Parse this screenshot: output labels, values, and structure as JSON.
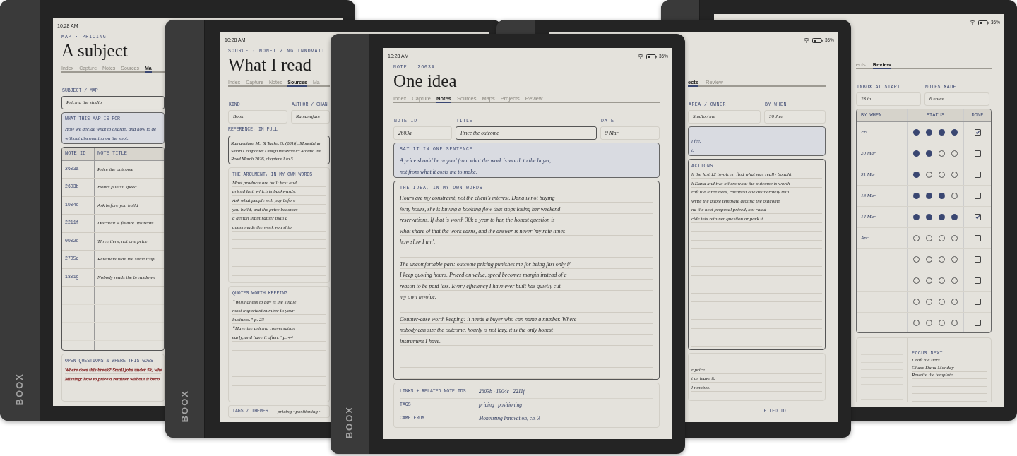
{
  "devices": [
    {
      "kind": "map",
      "brand": "BOOX",
      "status_bar": {
        "time": "10:28 AM"
      },
      "eyebrow": "MAP · PRICING",
      "title": "A subject",
      "tabs": [
        {
          "label": "Index",
          "selected": false
        },
        {
          "label": "Capture",
          "selected": false
        },
        {
          "label": "Notes",
          "selected": false
        },
        {
          "label": "Sources",
          "selected": false
        },
        {
          "label": "Ma",
          "selected": true
        }
      ],
      "sections": [
        {
          "kind": "fields",
          "fields": [
            {
              "label": "SUBJECT / MAP",
              "value": "Pricing the studio",
              "focused": true
            }
          ]
        },
        {
          "kind": "callout",
          "label": "WHAT THIS MAP IS FOR",
          "lines": [
            "How we decide what to charge, and how to de",
            "without discounting on the spot."
          ]
        },
        {
          "kind": "table",
          "columns": [
            "NOTE ID",
            "NOTE TITLE"
          ],
          "rows": [
            {
              "cells": [
                "2603a",
                "Price the outcome"
              ]
            },
            {
              "cells": [
                "2603b",
                "Hours punish speed"
              ]
            },
            {
              "cells": [
                "1904c",
                "Ask before you build"
              ]
            },
            {
              "cells": [
                "2211f",
                "Discount = failure upstream."
              ]
            },
            {
              "cells": [
                "0902d",
                "Three tiers, not one price"
              ]
            },
            {
              "cells": [
                "2705e",
                "Retainers hide the same trap"
              ]
            },
            {
              "cells": [
                "1801g",
                "Nobody reads the breakdown"
              ]
            }
          ]
        },
        {
          "kind": "ruled_card",
          "label": "OPEN QUESTIONS & WHERE THIS GOES",
          "color": "#8a2f2f",
          "paragraphs": [
            [
              "Where does this break? Small jobs under 5k, whe",
              "Missing: how to price a retainer without it beco"
            ]
          ]
        }
      ]
    },
    {
      "kind": "source",
      "brand": "BOOX",
      "status_bar": {
        "time": "10:28 AM"
      },
      "eyebrow": "SOURCE · MONETIZING INNOVATI",
      "title": "What I read",
      "tabs": [
        {
          "label": "Index",
          "selected": false
        },
        {
          "label": "Capture",
          "selected": false
        },
        {
          "label": "Notes",
          "selected": false
        },
        {
          "label": "Sources",
          "selected": true
        },
        {
          "label": "Ma",
          "selected": false
        }
      ],
      "sections": [
        {
          "kind": "fields",
          "fields": [
            {
              "label": "KIND",
              "value": "Book",
              "focused": false
            },
            {
              "label": "AUTHOR / CHAN",
              "value": "Ramanujam",
              "focused": false
            }
          ]
        },
        {
          "kind": "reference",
          "label": "REFERENCE, IN FULL",
          "lines": [
            "Ramanujam, M., & Tacke, G. (2016). Monetizing",
            "Smart Companies Design the Product Around the",
            "Read March 2026, chapters 1 to 3."
          ]
        },
        {
          "kind": "ruled_panel",
          "label": "THE ARGUMENT, IN MY OWN WORDS",
          "paragraphs": [
            [
              "Most products are built first and",
              "priced last, which is backwards.",
              "Ask what people will pay before",
              "you build, and the price becomes",
              "a design input rather than a",
              "guess made the week you ship."
            ]
          ]
        },
        {
          "kind": "ruled_panel",
          "label": "QUOTES WORTH KEEPING",
          "paragraphs": [
            [
              "“Willingness to pay is the single",
              "most important number in your",
              "business.” p. 23",
              "“Have the pricing conversation",
              "early, and have it often.” p. 44"
            ]
          ]
        },
        {
          "kind": "tags",
          "label": "TAGS / THEMES",
          "value": "pricing · positioning ·"
        }
      ]
    },
    {
      "kind": "note",
      "brand": "BOOX",
      "status_bar": {
        "time": "10:28 AM",
        "battery": "36%"
      },
      "eyebrow": "NOTE · 2603A",
      "title": "One idea",
      "tabs": [
        {
          "label": "Index",
          "selected": false
        },
        {
          "label": "Capture",
          "selected": false
        },
        {
          "label": "Notes",
          "selected": true
        },
        {
          "label": "Sources",
          "selected": false
        },
        {
          "label": "Maps",
          "selected": false
        },
        {
          "label": "Projects",
          "selected": false
        },
        {
          "label": "Review",
          "selected": false
        }
      ],
      "sections": [
        {
          "kind": "fields",
          "fields": [
            {
              "label": "NOTE ID",
              "value": "2603a",
              "focused": false
            },
            {
              "label": "TITLE",
              "value": "Price the outcome",
              "focused": true
            },
            {
              "label": "DATE",
              "value": "9 Mar",
              "focused": false
            }
          ]
        },
        {
          "kind": "callout",
          "label": "SAY IT IN ONE SENTENCE",
          "lines": [
            "A price should be argued from what the work is worth to the buyer,",
            "not from what it costs me to make."
          ]
        },
        {
          "kind": "ruled_box",
          "label": "THE IDEA, IN MY OWN WORDS",
          "paragraphs": [
            [
              "Hours are my constraint, not the client's interest. Dana is not buying",
              "forty hours, she is buying a booking flow that stops losing her weekend",
              "reservations. If that is worth 30k a year to her, the honest question is",
              "what share of that the work earns, and the answer is never 'my rate times",
              "how slow I am'."
            ],
            [
              "The uncomfortable part: outcome pricing punishes me for being fast only if",
              "I keep quoting hours. Priced on value, speed becomes margin instead of a",
              "reason to be paid less. Every efficiency I have ever built has quietly cut",
              "my own invoice."
            ],
            [
              "Counter-case worth keeping: it needs a buyer who can name a number. Where",
              "nobody can size the outcome, hourly is not lazy, it is the only honest",
              "instrument I have."
            ]
          ]
        },
        {
          "kind": "meta",
          "rows": [
            {
              "label": "LINKS + RELATED NOTE IDS",
              "value": "2603b · 1904c · 2211f"
            },
            {
              "label": "TAGS",
              "value": "pricing · positioning"
            },
            {
              "label": "CAME FROM",
              "value": "Monetizing Innovation, ch. 3"
            }
          ]
        }
      ]
    },
    {
      "kind": "project",
      "status_bar": {
        "battery": "36%"
      },
      "tabs": [
        {
          "label": "ects",
          "selected": true
        },
        {
          "label": "Review",
          "selected": false
        }
      ],
      "sections": [
        {
          "kind": "fields",
          "fields": [
            {
              "label": "AREA / OWNER",
              "value": "Studio / me",
              "focused": false
            },
            {
              "label": "BY WHEN",
              "value": "30 Jun",
              "focused": false
            }
          ]
        },
        {
          "kind": "callout",
          "lines": [
            "l fee.",
            "t."
          ]
        },
        {
          "kind": "ruled_box",
          "label": "ACTIONS",
          "paragraphs": [
            [
              "ll the last 12 invoices; find what was really bought",
              "k Dana and two others what the outcome is worth",
              "raft the three tiers, cheapest one deliberately thin",
              "write the quote template around the outcome",
              "nd the next proposal priced, not rated",
              "cide this retainer question or park it"
            ]
          ]
        },
        {
          "kind": "ruled_card",
          "paragraphs": [
            [
              "r price.",
              "t or leave it.",
              "l number."
            ]
          ]
        },
        {
          "kind": "filed",
          "label": "FILED TO"
        }
      ]
    },
    {
      "kind": "review",
      "status_bar": {
        "battery": "36%"
      },
      "tabs": [
        {
          "label": "ects",
          "selected": false
        },
        {
          "label": "Review",
          "selected": true
        }
      ],
      "sections": [
        {
          "kind": "fields",
          "fields": [
            {
              "label": "INBOX AT START",
              "value": "23 in",
              "focused": false
            },
            {
              "label": "NOTES MADE",
              "value": "6 notes",
              "focused": false
            }
          ]
        },
        {
          "kind": "status_table",
          "columns": [
            "BY WHEN",
            "STATUS",
            "DONE"
          ],
          "rows": [
            {
              "by_when": "Fri",
              "stars": 4,
              "done": true
            },
            {
              "by_when": "20 Mar",
              "stars": 2,
              "done": false
            },
            {
              "by_when": "31 Mar",
              "stars": 1,
              "done": false
            },
            {
              "by_when": "18 Mar",
              "stars": 3,
              "done": false
            },
            {
              "by_when": "14 Mar",
              "stars": 4,
              "done": true
            },
            {
              "by_when": "Apr",
              "stars": 0,
              "done": false
            },
            {
              "stars": 0,
              "done": false
            },
            {
              "stars": 0,
              "done": false
            },
            {
              "stars": 0,
              "done": false
            },
            {
              "stars": 0,
              "done": false
            }
          ]
        },
        {
          "kind": "focus",
          "label": "FOCUS NEXT",
          "lines": [
            "Draft the tiers",
            "Chase Dana Monday",
            "Rewrite the template"
          ]
        }
      ]
    }
  ]
}
